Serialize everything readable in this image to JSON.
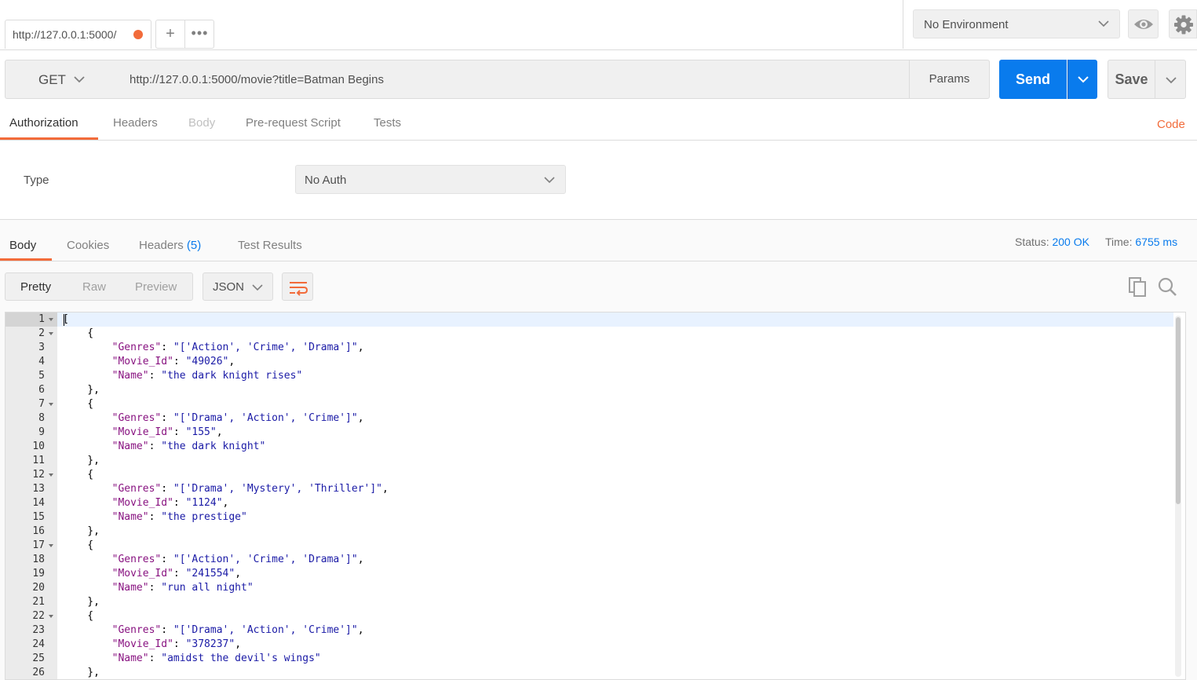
{
  "tabs": {
    "active_tab_label": "http://127.0.0.1:5000/",
    "new_tab_label": "+",
    "more_label": "•••"
  },
  "environment": {
    "selected": "No Environment",
    "eye_icon": "eye-icon",
    "settings_icon": "gear-icon"
  },
  "request": {
    "method": "GET",
    "url": "http://127.0.0.1:5000/movie?title=Batman Begins",
    "params_label": "Params",
    "send_label": "Send",
    "save_label": "Save"
  },
  "request_tabs": {
    "items": [
      "Authorization",
      "Headers",
      "Body",
      "Pre-request Script",
      "Tests"
    ],
    "active": "Authorization",
    "code_link": "Code"
  },
  "auth": {
    "type_label": "Type",
    "type_value": "No Auth"
  },
  "response_tabs": {
    "body": "Body",
    "cookies": "Cookies",
    "headers": "Headers",
    "headers_count": "(5)",
    "test_results": "Test Results",
    "status_label": "Status:",
    "status_value": "200 OK",
    "time_label": "Time:",
    "time_value": "6755 ms"
  },
  "response_view": {
    "pretty": "Pretty",
    "raw": "Raw",
    "preview": "Preview",
    "format": "JSON",
    "wrap_icon": "wrap-lines-icon",
    "copy_icon": "copy-icon",
    "search_icon": "search-icon"
  },
  "code_lines": [
    {
      "n": "1",
      "fold": true,
      "indent": 0,
      "text": "["
    },
    {
      "n": "2",
      "fold": true,
      "indent": 1,
      "text": "{"
    },
    {
      "n": "3",
      "indent": 2,
      "key": "\"Genres\"",
      "val": "\"['Action', 'Crime', 'Drama']\"",
      "end": ","
    },
    {
      "n": "4",
      "indent": 2,
      "key": "\"Movie_Id\"",
      "val": "\"49026\"",
      "end": ","
    },
    {
      "n": "5",
      "indent": 2,
      "key": "\"Name\"",
      "val": "\"the dark knight rises\"",
      "end": ""
    },
    {
      "n": "6",
      "indent": 1,
      "text": "},"
    },
    {
      "n": "7",
      "fold": true,
      "indent": 1,
      "text": "{"
    },
    {
      "n": "8",
      "indent": 2,
      "key": "\"Genres\"",
      "val": "\"['Drama', 'Action', 'Crime']\"",
      "end": ","
    },
    {
      "n": "9",
      "indent": 2,
      "key": "\"Movie_Id\"",
      "val": "\"155\"",
      "end": ","
    },
    {
      "n": "10",
      "indent": 2,
      "key": "\"Name\"",
      "val": "\"the dark knight\"",
      "end": ""
    },
    {
      "n": "11",
      "indent": 1,
      "text": "},"
    },
    {
      "n": "12",
      "fold": true,
      "indent": 1,
      "text": "{"
    },
    {
      "n": "13",
      "indent": 2,
      "key": "\"Genres\"",
      "val": "\"['Drama', 'Mystery', 'Thriller']\"",
      "end": ","
    },
    {
      "n": "14",
      "indent": 2,
      "key": "\"Movie_Id\"",
      "val": "\"1124\"",
      "end": ","
    },
    {
      "n": "15",
      "indent": 2,
      "key": "\"Name\"",
      "val": "\"the prestige\"",
      "end": ""
    },
    {
      "n": "16",
      "indent": 1,
      "text": "},"
    },
    {
      "n": "17",
      "fold": true,
      "indent": 1,
      "text": "{"
    },
    {
      "n": "18",
      "indent": 2,
      "key": "\"Genres\"",
      "val": "\"['Action', 'Crime', 'Drama']\"",
      "end": ","
    },
    {
      "n": "19",
      "indent": 2,
      "key": "\"Movie_Id\"",
      "val": "\"241554\"",
      "end": ","
    },
    {
      "n": "20",
      "indent": 2,
      "key": "\"Name\"",
      "val": "\"run all night\"",
      "end": ""
    },
    {
      "n": "21",
      "indent": 1,
      "text": "},"
    },
    {
      "n": "22",
      "fold": true,
      "indent": 1,
      "text": "{"
    },
    {
      "n": "23",
      "indent": 2,
      "key": "\"Genres\"",
      "val": "\"['Drama', 'Action', 'Crime']\"",
      "end": ","
    },
    {
      "n": "24",
      "indent": 2,
      "key": "\"Movie_Id\"",
      "val": "\"378237\"",
      "end": ","
    },
    {
      "n": "25",
      "indent": 2,
      "key": "\"Name\"",
      "val": "\"amidst the devil's wings\"",
      "end": ""
    },
    {
      "n": "26",
      "indent": 1,
      "text": "},"
    }
  ],
  "colors": {
    "accent": "#f26b3a",
    "send_blue": "#097bed",
    "json_key": "#881280",
    "json_string": "#1a1aa6"
  }
}
